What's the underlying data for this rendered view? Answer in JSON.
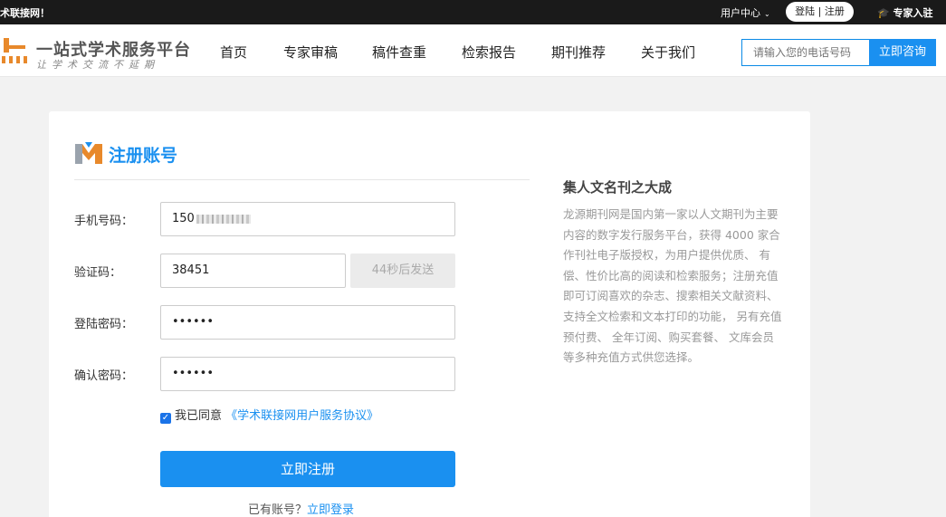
{
  "topbar": {
    "welcome": "术联接网！",
    "user_center": "用户中心",
    "login_register": "登陆 | 注册",
    "expert_join": "专家入驻"
  },
  "header": {
    "logo_title": "一站式学术服务平台",
    "logo_sub": "让学术交流不延期",
    "nav": [
      "首页",
      "专家审稿",
      "稿件查重",
      "检索报告",
      "期刊推荐",
      "关于我们"
    ],
    "search_placeholder": "请输入您的电话号码",
    "search_button": "立即咨询"
  },
  "form": {
    "title": "注册账号",
    "phone_label": "手机号码：",
    "phone_value": "150",
    "code_label": "验证码：",
    "code_value": "38451",
    "code_button": "44秒后发送",
    "password_label": "登陆密码：",
    "password_value": "••••••",
    "confirm_label": "确认密码：",
    "confirm_value": "••••••",
    "agree_text": "我已同意",
    "agree_link": "《学术联接网用户服务协议》",
    "submit": "立即注册",
    "have_account": "已有账号？",
    "login_link": "立即登录"
  },
  "sidebar": {
    "title": "集人文名刊之大成",
    "text": "龙源期刊网是国内第一家以人文期刊为主要内容的数字发行服务平台，获得 4000 家合作刊社电子版授权，为用户提供优质、 有偿、性价比高的阅读和检索服务；注册充值即可订阅喜欢的杂志、搜索相关文献资料、支持全文检索和文本打印的功能， 另有充值预付费、 全年订阅、购买套餐、 文库会员等多种充值方式供您选择。"
  },
  "colors": {
    "accent": "#1a90f0",
    "topbar_bg": "#1a1a1a",
    "page_bg": "#f2f2f2"
  }
}
